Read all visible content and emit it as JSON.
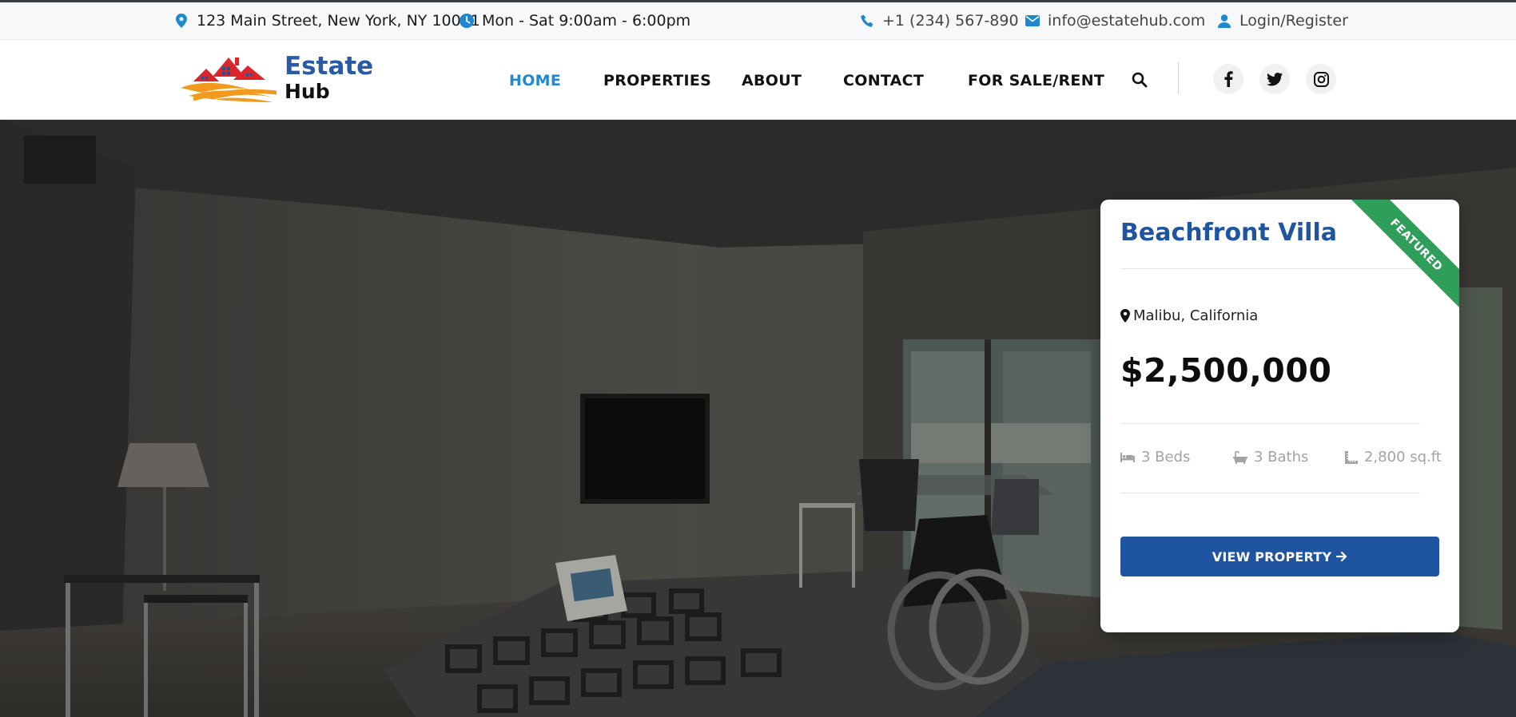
{
  "topbar": {
    "address": "123 Main Street, New York, NY 10001",
    "hours": "Mon - Sat 9:00am - 6:00pm",
    "phone": "+1 (234) 567-890",
    "email": "info@estatehub.com",
    "account": "Login/Register"
  },
  "brand": {
    "line1": "Estate",
    "line2": "Hub"
  },
  "nav": {
    "items": [
      "HOME",
      "PROPERTIES",
      "ABOUT",
      "CONTACT",
      "FOR SALE/RENT"
    ],
    "active": "HOME"
  },
  "social": [
    "facebook-icon",
    "twitter-icon",
    "instagram-icon"
  ],
  "card": {
    "ribbon": "FEATURED",
    "title": "Beachfront Villa",
    "location": "Malibu, California",
    "price": "$2,500,000",
    "beds": "3 Beds",
    "baths": "3 Baths",
    "area": "2,800 sq.ft",
    "button": "VIEW PROPERTY"
  },
  "colors": {
    "accent": "#1e88d0",
    "brand_blue": "#1f55a0",
    "ribbon_green": "#2e9e5a",
    "logo_red": "#d8262b",
    "logo_orange": "#f29a1d"
  }
}
